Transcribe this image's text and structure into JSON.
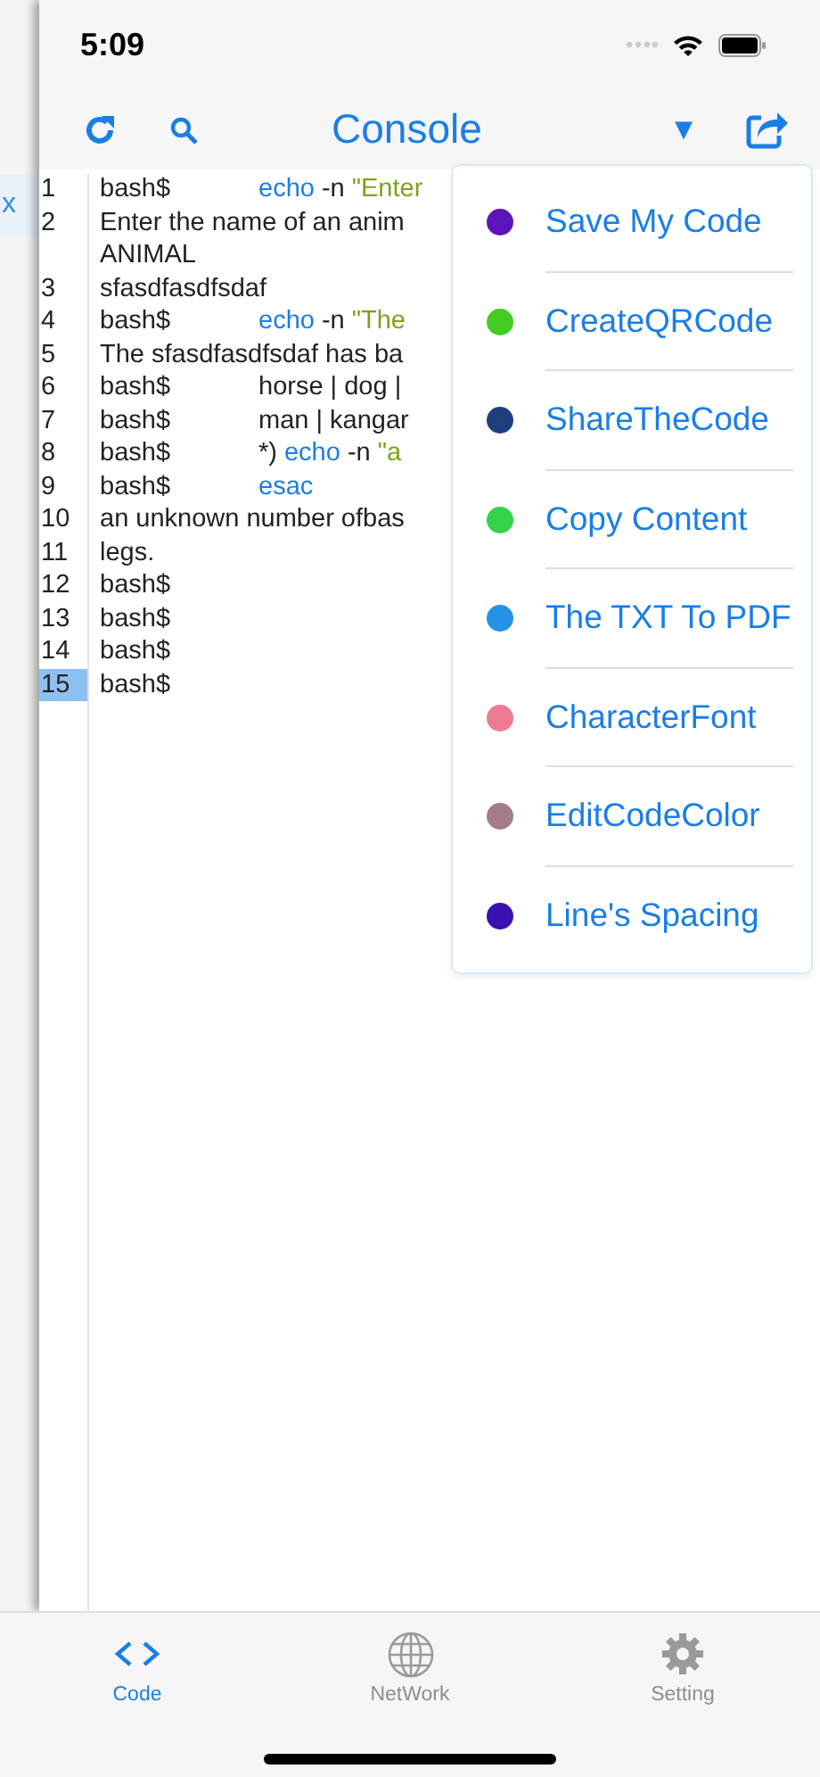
{
  "status_bar": {
    "time": "5:09"
  },
  "side_panel": {
    "close_label": "x"
  },
  "nav_bar": {
    "title": "Console",
    "dropdown_glyph": "▼"
  },
  "editor": {
    "rows": [
      {
        "number": "1",
        "selected": false,
        "prompt": "bash$",
        "code": [
          {
            "text": "echo",
            "kind": "keyword"
          },
          {
            "text": "-n",
            "kind": "plain"
          },
          {
            "text": "\"Enter",
            "kind": "string"
          }
        ]
      },
      {
        "number": "2",
        "selected": false,
        "code": [
          {
            "text": "Enter the name of an anim",
            "kind": "plain"
          }
        ]
      },
      {
        "code": [
          {
            "text": "ANIMAL",
            "kind": "plain"
          }
        ]
      },
      {
        "number": "3",
        "selected": false,
        "code": [
          {
            "text": "sfasdfasdfsdaf",
            "kind": "plain"
          }
        ]
      },
      {
        "number": "4",
        "selected": false,
        "prompt": "bash$",
        "code": [
          {
            "text": "echo",
            "kind": "keyword"
          },
          {
            "text": "-n",
            "kind": "plain"
          },
          {
            "text": "\"The",
            "kind": "string"
          }
        ]
      },
      {
        "number": "5",
        "selected": false,
        "code": [
          {
            "text": "The sfasdfasdfsdaf has ba",
            "kind": "plain"
          }
        ]
      },
      {
        "number": "6",
        "selected": false,
        "prompt": "bash$",
        "code": [
          {
            "text": "horse | dog |",
            "kind": "plain"
          }
        ]
      },
      {
        "number": "7",
        "selected": false,
        "prompt": "bash$",
        "code": [
          {
            "text": "man | kangar",
            "kind": "plain"
          }
        ]
      },
      {
        "number": "8",
        "selected": false,
        "prompt": "bash$",
        "code": [
          {
            "text": "*)",
            "kind": "plain"
          },
          {
            "text": "echo",
            "kind": "keyword"
          },
          {
            "text": "-n",
            "kind": "plain"
          },
          {
            "text": "\"a",
            "kind": "string"
          }
        ]
      },
      {
        "number": "9",
        "selected": false,
        "prompt": "bash$",
        "code": [
          {
            "text": "esac",
            "kind": "keyword"
          }
        ]
      },
      {
        "number": "10",
        "selected": false,
        "code": [
          {
            "text": "an unknown number ofbas",
            "kind": "plain"
          }
        ]
      },
      {
        "number": "11",
        "selected": false,
        "code": [
          {
            "text": "legs.",
            "kind": "plain"
          }
        ]
      },
      {
        "number": "12",
        "selected": false,
        "prompt": "bash$"
      },
      {
        "number": "13",
        "selected": false,
        "prompt": "bash$"
      },
      {
        "number": "14",
        "selected": false,
        "prompt": "bash$"
      },
      {
        "number": "15",
        "selected": true,
        "prompt": "bash$"
      }
    ]
  },
  "menu": {
    "items": [
      {
        "label": "Save My Code",
        "color": "#5b14b8"
      },
      {
        "label": "CreateQRCode",
        "color": "#44cc22"
      },
      {
        "label": "ShareTheCode",
        "color": "#1e3f7e"
      },
      {
        "label": "Copy Content",
        "color": "#33d449"
      },
      {
        "label": "The TXT To PDF",
        "color": "#2492e6"
      },
      {
        "label": "CharacterFont",
        "color": "#ee7a92"
      },
      {
        "label": "EditCodeColor",
        "color": "#a47d88"
      },
      {
        "label": "Line's Spacing",
        "color": "#3a10b0"
      }
    ]
  },
  "tab_bar": {
    "tabs": [
      {
        "label": "Code",
        "kind": "code",
        "selected": true
      },
      {
        "label": "NetWork",
        "kind": "network",
        "selected": false
      },
      {
        "label": "Setting",
        "kind": "setting",
        "selected": false
      }
    ]
  }
}
